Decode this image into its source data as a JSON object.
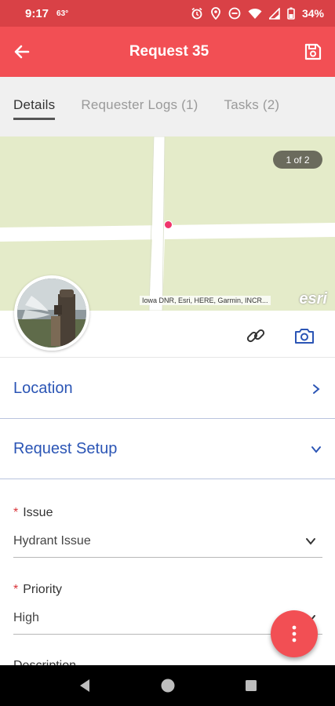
{
  "status_bar": {
    "time": "9:17",
    "temp": "63°",
    "battery": "34%"
  },
  "app_bar": {
    "title": "Request 35"
  },
  "tabs": [
    {
      "label": "Details",
      "active": true
    },
    {
      "label": "Requester Logs (1)",
      "active": false
    },
    {
      "label": "Tasks (2)",
      "active": false
    }
  ],
  "map": {
    "page_indicator": "1 of 2",
    "attribution": "Iowa DNR, Esri, HERE, Garmin, INCR...",
    "logo": "esri",
    "colors": {
      "land": "#e4ebc9",
      "road": "#ffffff",
      "marker": "#f0356c"
    }
  },
  "sections": {
    "location": {
      "label": "Location",
      "expanded": false
    },
    "request_setup": {
      "label": "Request Setup",
      "expanded": true
    }
  },
  "fields": {
    "issue": {
      "required_mark": "*",
      "label": "Issue",
      "value": "Hydrant Issue"
    },
    "priority": {
      "required_mark": "*",
      "label": "Priority",
      "value": "High"
    },
    "description": {
      "label": "Description"
    }
  },
  "colors": {
    "primary": "#f24f54",
    "section_text": "#2b55b5",
    "required": "#d9343a"
  },
  "icons": {
    "back": "arrow-left-icon",
    "save": "save-icon",
    "link": "link-icon",
    "camera": "camera-icon",
    "fab": "more-vertical-icon"
  }
}
